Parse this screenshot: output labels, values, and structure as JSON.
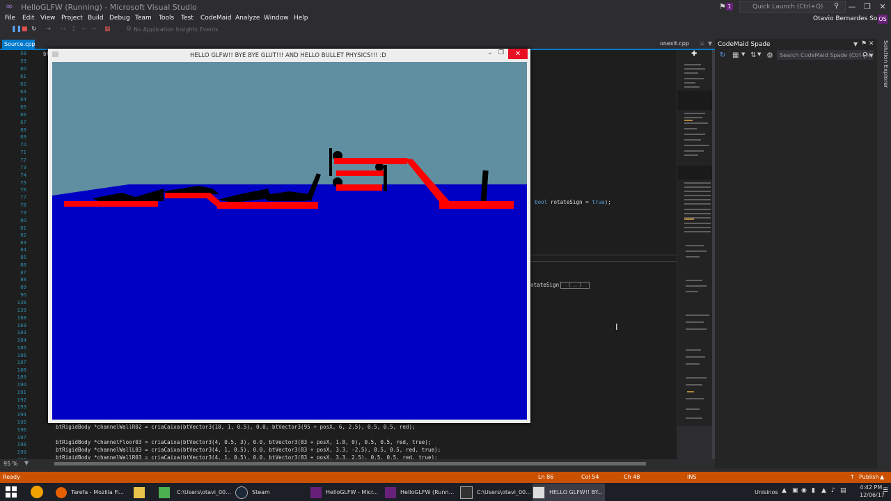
{
  "window": {
    "title": "HelloGLFW (Running) - Microsoft Visual Studio",
    "notification_count": "1",
    "quick_launch_placeholder": "Quick Launch (Ctrl+Q)",
    "user_name": "Otavio Bernardes Soria",
    "user_initials": "OS"
  },
  "menu": [
    "File",
    "Edit",
    "View",
    "Project",
    "Build",
    "Debug",
    "Team",
    "Tools",
    "Test",
    "CodeMaid",
    "Analyze",
    "Window",
    "Help"
  ],
  "toolbar": {
    "insights_label": "No Application Insights Events"
  },
  "tabs": {
    "active": "Source.cpp",
    "secondary": "onexit.cpp"
  },
  "editor": {
    "zoom": "95 %",
    "line_numbers": [
      "58",
      "59",
      "60",
      "61",
      "62",
      "63",
      "64",
      "65",
      "66",
      "67",
      "68",
      "69",
      "70",
      "71",
      "72",
      "73",
      "74",
      "75",
      "76",
      "77",
      "78",
      "79",
      "80",
      "81",
      "82",
      "83",
      "84",
      "85",
      "86",
      "87",
      "88",
      "89",
      "90",
      "138",
      "139",
      "168",
      "169",
      "183",
      "184",
      "185",
      "186",
      "187",
      "188",
      "189",
      "190",
      "191",
      "192",
      "193",
      "194",
      "195",
      "196",
      "197",
      "198",
      "199",
      "200",
      "201"
    ],
    "fragments": {
      "rotate_sign": "bool rotateSign = true);",
      "rotate_sign2": "otateSign)",
      "collapsed": "{ ... }",
      "code_197": "btRigidBody *channelWallR02 = criaCaixa(btVector3(10, 1, 0.5), 0.0, btVector3(95 + posX, 6, 2.5), 0.5, 0.5, red);",
      "code_199": "btRigidBody *channelFloor03 = criaCaixa(btVector3(4, 0.5, 3), 0.0, btVector3(83 + posX, 1.8, 0), 0.5, 0.5, red, true);",
      "code_200": "btRigidBody *channelWallL03 = criaCaixa(btVector3(4, 1, 0.5), 0.0, btVector3(83 + posX, 3.3, -2.5), 0.5, 0.5, red, true);",
      "code_201": "btRigidBody *channelWallR03 = criaCaixa(btVector3(4, 1, 0.5), 0.0, btVector3(83 + posX, 3.3, 2.5), 0.5, 0.5, red, true);"
    }
  },
  "gl_window": {
    "title": "HELLO GLFW!! BYE BYE GLUT!!! AND HELLO BULLET PHYSICS!!! :D"
  },
  "codemaid": {
    "title": "CodeMaid Spade",
    "search_placeholder": "Search CodeMaid Spade (Ctrl+M"
  },
  "side_panel": {
    "label": "Solution Explorer"
  },
  "statusbar": {
    "state": "Ready",
    "ln": "Ln 86",
    "col": "Col 54",
    "ch": "Ch 48",
    "mode": "INS",
    "publish": "Publish"
  },
  "taskbar": {
    "items": [
      "Tarefa - Mozilla Fi...",
      "",
      "",
      "C:\\Users\\otavi_00...",
      "Steam",
      "HelloGLFW - Micr...",
      "HelloGLFW (Runn...",
      "C:\\Users\\otavi_00...",
      "HELLO GLFW!! BY..."
    ],
    "tray_label": "Unisinos",
    "time": "4:42 PM",
    "date": "12/06/17"
  },
  "colors": {
    "accent": "#007acc",
    "status": "#ca5100",
    "sky": "#5f8fa0",
    "ground": "#0000c4",
    "block": "#ff0000"
  }
}
